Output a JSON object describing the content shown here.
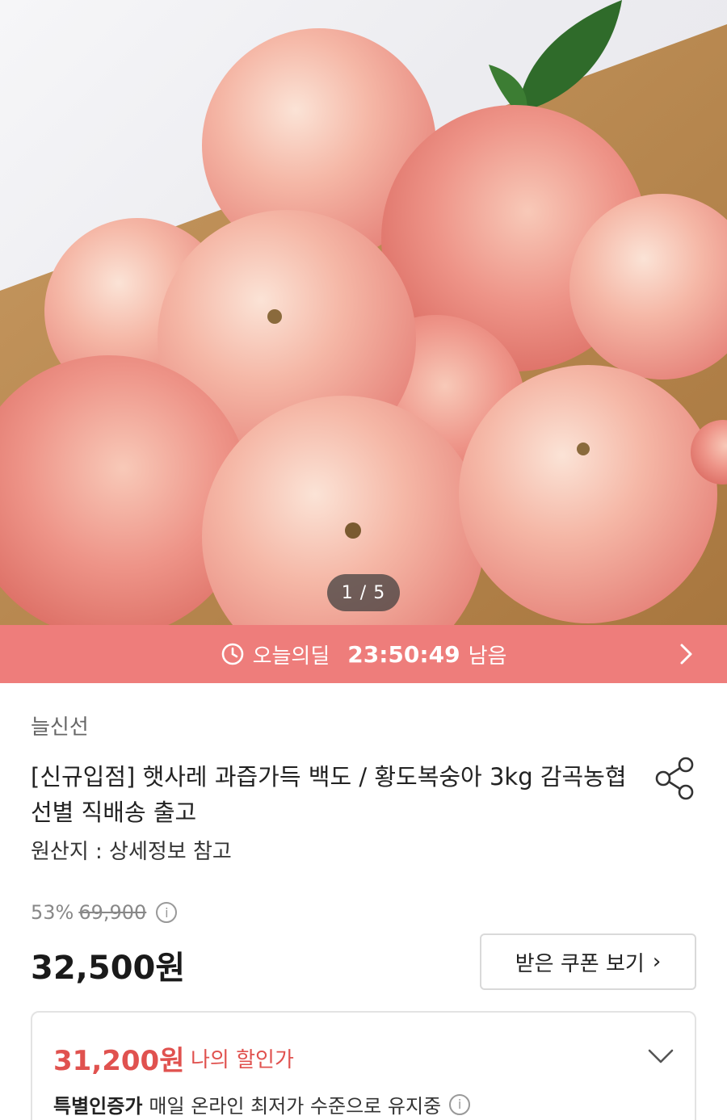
{
  "gallery": {
    "pager": "1 / 5"
  },
  "deal": {
    "label": "오늘의딜",
    "timer": "23:50:49",
    "remain": "남음"
  },
  "product": {
    "seller": "늘신선",
    "title": "[신규입점] 햇사레 과즙가득 백도 / 황도복숭아 3kg 감곡농협 선별 직배송 출고",
    "origin": "원산지 : 상세정보 참고",
    "discount_percent": "53%",
    "original_price": "69,900",
    "price": "32,500원",
    "coupon_button": "받은 쿠폰 보기",
    "coupon_arrow": "›",
    "my_price": "31,200원",
    "my_price_label": "나의 할인가",
    "special_label": "특별인증가",
    "special_text": "매일 온라인 최저가 수준으로 유지중"
  },
  "icons": {
    "clock": "clock-icon",
    "chevron_right": "chevron-right-icon",
    "share": "share-icon",
    "info": "info-icon",
    "chevron_down": "chevron-down-icon"
  },
  "colors": {
    "deal_banner": "#ee7d7b",
    "discount_price": "#e0524f"
  }
}
